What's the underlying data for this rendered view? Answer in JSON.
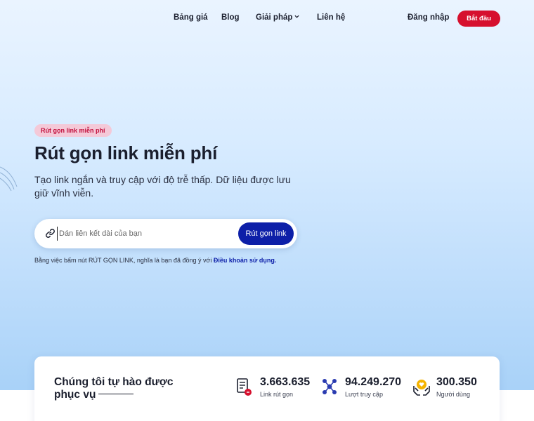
{
  "nav": {
    "pricing": "Bảng giá",
    "blog": "Blog",
    "solutions": "Giải pháp",
    "contact": "Liên hệ",
    "login": "Đăng nhập",
    "start": "Bắt đầu"
  },
  "hero": {
    "badge": "Rút gọn link miễn phí",
    "title": "Rút gọn link miễn phí",
    "subtitle": "Tạo link ngắn và truy cập với độ trễ thấp. Dữ liệu được lưu giữ vĩnh viễn.",
    "input_placeholder": "Dán liên kết dài của bạn",
    "shorten_button": "Rút gọn link",
    "terms_prefix": "Bằng việc bấm nút RÚT GỌN LINK, nghĩa là bạn đã đồng ý với ",
    "terms_link": "Điều khoản sử dụng."
  },
  "stats": {
    "title": "Chúng tôi tự hào được phục vụ",
    "items": [
      {
        "value": "3.663.635",
        "label": "Link rút gọn",
        "icon": "document-link-icon"
      },
      {
        "value": "94.249.270",
        "label": "Lượt truy cập",
        "icon": "network-icon"
      },
      {
        "value": "300.350",
        "label": "Người dùng",
        "icon": "hands-heart-icon"
      }
    ]
  },
  "colors": {
    "accent_red": "#d6102e",
    "primary_blue": "#0d1fa8",
    "badge_bg": "#f4c9d8"
  }
}
